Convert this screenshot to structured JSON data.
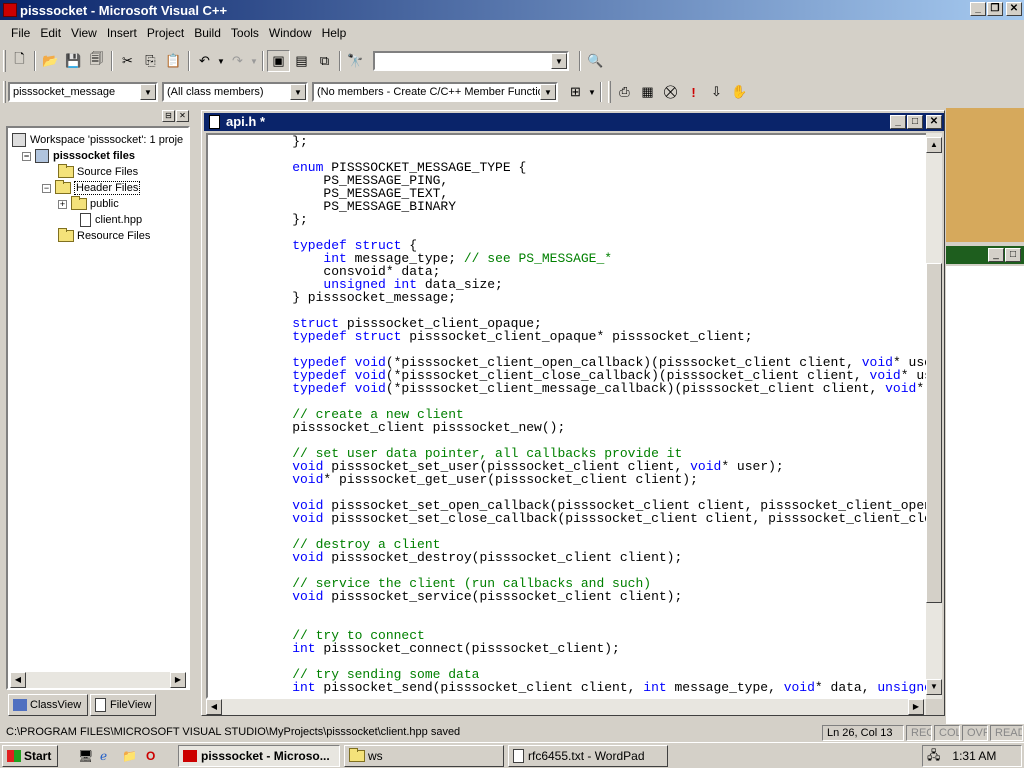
{
  "window": {
    "title": "pisssocket - Microsoft Visual C++"
  },
  "menu": [
    "File",
    "Edit",
    "View",
    "Insert",
    "Project",
    "Build",
    "Tools",
    "Window",
    "Help"
  ],
  "toolbar": {
    "find_combo_value": "",
    "class_combo": "pisssocket_message",
    "filter_combo": "(All class members)",
    "members_combo": "(No members - Create C/C++ Member Function..."
  },
  "workspace": {
    "root": "Workspace 'pisssocket': 1 proje",
    "project": "pisssocket files",
    "source_files": "Source Files",
    "header_files": "Header Files",
    "public": "public",
    "client_hpp": "client.hpp",
    "resource_files": "Resource Files",
    "tab_classview": "ClassView",
    "tab_fileview": "FileView"
  },
  "editor": {
    "title": "api.h *",
    "lines": [
      [
        [
          "",
          "    };"
        ]
      ],
      [
        [
          "",
          ""
        ]
      ],
      [
        [
          "kw",
          "    enum"
        ],
        [
          "",
          " PISSSOCKET_MESSAGE_TYPE {"
        ]
      ],
      [
        [
          "",
          "        PS_MESSAGE_PING,"
        ]
      ],
      [
        [
          "",
          "        PS_MESSAGE_TEXT,"
        ]
      ],
      [
        [
          "",
          "        PS_MESSAGE_BINARY"
        ]
      ],
      [
        [
          "",
          "    };"
        ]
      ],
      [
        [
          "",
          ""
        ]
      ],
      [
        [
          "kw",
          "    typedef struct"
        ],
        [
          "",
          " {"
        ]
      ],
      [
        [
          "kw",
          "        int"
        ],
        [
          "",
          " message_type; "
        ],
        [
          "cm",
          "// see PS_MESSAGE_*"
        ]
      ],
      [
        [
          "",
          "        consvoid* data;"
        ]
      ],
      [
        [
          "kw",
          "        unsigned int"
        ],
        [
          "",
          " data_size;"
        ]
      ],
      [
        [
          "",
          "    } pisssocket_message;"
        ]
      ],
      [
        [
          "",
          ""
        ]
      ],
      [
        [
          "kw",
          "    struct"
        ],
        [
          "",
          " pisssocket_client_opaque;"
        ]
      ],
      [
        [
          "kw",
          "    typedef struct"
        ],
        [
          "",
          " pisssocket_client_opaque* pisssocket_client;"
        ]
      ],
      [
        [
          "",
          ""
        ]
      ],
      [
        [
          "kw",
          "    typedef void"
        ],
        [
          "",
          "(*pisssocket_client_open_callback)(pisssocket_client client, "
        ],
        [
          "kw",
          "void"
        ],
        [
          "",
          "* user"
        ]
      ],
      [
        [
          "kw",
          "    typedef void"
        ],
        [
          "",
          "(*pisssocket_client_close_callback)(pisssocket_client client, "
        ],
        [
          "kw",
          "void"
        ],
        [
          "",
          "* use"
        ]
      ],
      [
        [
          "kw",
          "    typedef void"
        ],
        [
          "",
          "(*pisssocket_client_message_callback)(pisssocket_client client, "
        ],
        [
          "kw",
          "void"
        ],
        [
          "",
          "* d"
        ]
      ],
      [
        [
          "",
          ""
        ]
      ],
      [
        [
          "cm",
          "    // create a new client"
        ]
      ],
      [
        [
          "",
          "    pisssocket_client pisssocket_new();"
        ]
      ],
      [
        [
          "",
          ""
        ]
      ],
      [
        [
          "cm",
          "    // set user data pointer, all callbacks provide it"
        ]
      ],
      [
        [
          "kw",
          "    void"
        ],
        [
          "",
          " pisssocket_set_user(pisssocket_client client, "
        ],
        [
          "kw",
          "void"
        ],
        [
          "",
          "* user);"
        ]
      ],
      [
        [
          "kw",
          "    void"
        ],
        [
          "",
          "* pisssocket_get_user(pisssocket_client client);"
        ]
      ],
      [
        [
          "",
          ""
        ]
      ],
      [
        [
          "kw",
          "    void"
        ],
        [
          "",
          " pisssocket_set_open_callback(pisssocket_client client, pisssocket_client_open_c"
        ]
      ],
      [
        [
          "kw",
          "    void"
        ],
        [
          "",
          " pisssocket_set_close_callback(pisssocket_client client, pisssocket_client_close"
        ]
      ],
      [
        [
          "",
          ""
        ]
      ],
      [
        [
          "cm",
          "    // destroy a client"
        ]
      ],
      [
        [
          "kw",
          "    void"
        ],
        [
          "",
          " pisssocket_destroy(pisssocket_client client);"
        ]
      ],
      [
        [
          "",
          ""
        ]
      ],
      [
        [
          "cm",
          "    // service the client (run callbacks and such)"
        ]
      ],
      [
        [
          "kw",
          "    void"
        ],
        [
          "",
          " pisssocket_service(pisssocket_client client);"
        ]
      ],
      [
        [
          "",
          ""
        ]
      ],
      [
        [
          "",
          ""
        ]
      ],
      [
        [
          "cm",
          "    // try to connect"
        ]
      ],
      [
        [
          "kw",
          "    int"
        ],
        [
          "",
          " pisssocket_connect(pisssocket_client);"
        ]
      ],
      [
        [
          "",
          ""
        ]
      ],
      [
        [
          "cm",
          "    // try sending some data"
        ]
      ],
      [
        [
          "kw",
          "    int"
        ],
        [
          "",
          " pissocket_send(pisssocket_client client, "
        ],
        [
          "kw",
          "int"
        ],
        [
          "",
          " message_type, "
        ],
        [
          "kw",
          "void"
        ],
        [
          "",
          "* data, "
        ],
        [
          "kw",
          "unsigned"
        ]
      ]
    ]
  },
  "status": {
    "message": "C:\\PROGRAM FILES\\MICROSOFT VISUAL STUDIO\\MyProjects\\pisssocket\\client.hpp saved",
    "position": "Ln 26, Col 13",
    "rec": "REC",
    "col": "COL",
    "ovr": "OVR",
    "read": "READ"
  },
  "taskbar": {
    "start": "Start",
    "tasks": [
      "pisssocket - Microso...",
      "ws",
      "rfc6455.txt - WordPad"
    ],
    "clock": "1:31 AM"
  }
}
